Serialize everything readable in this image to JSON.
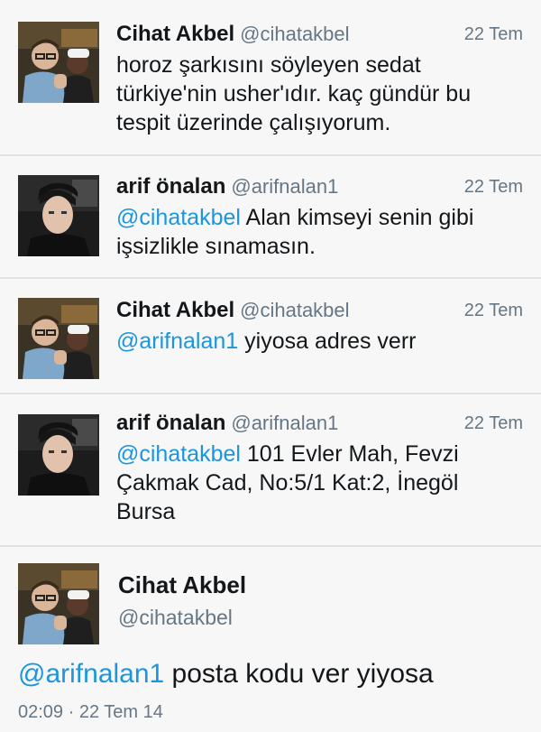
{
  "tweets": [
    {
      "name": "Cihat Akbel",
      "handle": "@cihatakbel",
      "time": "22 Tem",
      "lines": [
        "horoz şarkısını söyleyen sedat",
        "türkiye'nin usher'ıdır. kaç gündür bu",
        "tespit üzerinde çalışıyorum."
      ]
    },
    {
      "name": "arif önalan",
      "handle": "@arifnalan1",
      "time": "22 Tem",
      "mention": "@cihatakbel",
      "line1_rest": " Alan kimseyi senin gibi",
      "line2": "işsizlikle sınamasın."
    },
    {
      "name": "Cihat Akbel",
      "handle": "@cihatakbel",
      "time": "22 Tem",
      "mention": "@arifnalan1",
      "line1_rest": " yiyosa adres verr"
    },
    {
      "name": "arif önalan",
      "handle": "@arifnalan1",
      "time": "22 Tem",
      "mention": "@cihatakbel",
      "line1_rest": " 101 Evler Mah, Fevzi",
      "line2": "Çakmak Cad, No:5/1 Kat:2, İnegöl",
      "line3": "Bursa"
    }
  ],
  "detail": {
    "name": "Cihat Akbel",
    "handle": "@cihatakbel",
    "mention": "@arifnalan1",
    "text_rest": " posta kodu ver yiyosa",
    "meta": "02:09 · 22 Tem 14"
  },
  "colors": {
    "mention": "#1b95e0",
    "secondary": "#657786",
    "card_bg": "#f7f7f7"
  }
}
